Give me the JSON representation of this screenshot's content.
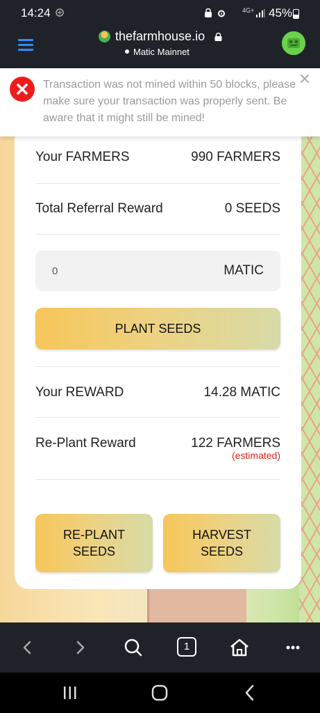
{
  "status_bar": {
    "time": "14:24",
    "network": "4G+",
    "battery": "45%",
    "battery_level": 0.45
  },
  "browser": {
    "site_title": "thefarmhouse.io",
    "network_label": "Matic Mainnet",
    "tab_count": "1"
  },
  "toast": {
    "message": "Transaction was not mined within 50 blocks, please make sure your transaction was properly sent. Be aware that it might still be mined!"
  },
  "stats": {
    "farmers_label": "Your FARMERS",
    "farmers_value": "990 FARMERS",
    "referral_label": "Total Referral Reward",
    "referral_value": "0 SEEDS"
  },
  "input": {
    "value": "0",
    "unit": "MATIC"
  },
  "buttons": {
    "plant": "PLANT SEEDS",
    "replant_line1": "RE-PLANT",
    "replant_line2": "SEEDS",
    "harvest_line1": "HARVEST",
    "harvest_line2": "SEEDS"
  },
  "rewards": {
    "reward_label": "Your REWARD",
    "reward_value": "14.28 MATIC",
    "replant_label": "Re-Plant Reward",
    "replant_value": "122 FARMERS",
    "estimated": "(estimated)"
  },
  "colors": {
    "error": "#ef1c1c",
    "accent_link": "#2f8cff",
    "estimated": "#e0241c",
    "button_start": "#f6c659",
    "button_end": "#d7dba8"
  }
}
